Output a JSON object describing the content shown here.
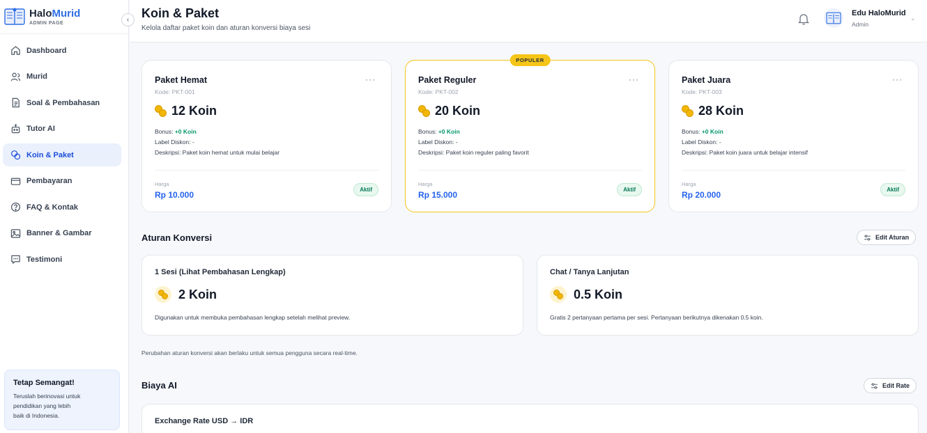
{
  "brand": {
    "name_main": "Halo",
    "name_accent": "Murid",
    "subtitle": "ADMIN PAGE"
  },
  "sidebar": {
    "items": [
      {
        "label": "Dashboard",
        "icon": "home-icon"
      },
      {
        "label": "Murid",
        "icon": "users-icon"
      },
      {
        "label": "Soal & Pembahasan",
        "icon": "document-icon"
      },
      {
        "label": "Tutor AI",
        "icon": "robot-icon"
      },
      {
        "label": "Koin & Paket",
        "icon": "coins-icon",
        "active": true
      },
      {
        "label": "Pembayaran",
        "icon": "card-icon"
      },
      {
        "label": "FAQ & Kontak",
        "icon": "help-icon"
      },
      {
        "label": "Banner & Gambar",
        "icon": "image-icon"
      },
      {
        "label": "Testimoni",
        "icon": "chat-icon"
      }
    ],
    "promo": {
      "title": "Tetap Semangat!",
      "text": "Teruslah berinovasi untuk pendidikan yang lebih baik di Indonesia."
    }
  },
  "header": {
    "title": "Koin & Paket",
    "subtitle": "Kelola daftar paket koin dan aturan konversi biaya sesi",
    "user": {
      "name": "Edu HaloMurid",
      "role": "Admin"
    }
  },
  "packages": [
    {
      "name": "Paket Hemat",
      "code": "Kode: PKT-001",
      "koin": "12 Koin",
      "bonus_label": "Bonus:",
      "bonus": "+0 Koin",
      "diskon": "Label Diskon: -",
      "deskripsi": "Deskripsi: Paket koin hemat untuk mulai belajar",
      "price_label": "Harga",
      "price": "Rp 10.000",
      "status": "Aktif",
      "menu": "···"
    },
    {
      "name": "Paket Reguler",
      "code": "Kode: PKT-002",
      "koin": "20 Koin",
      "bonus_label": "Bonus:",
      "bonus": "+0 Koin",
      "diskon": "Label Diskon: -",
      "deskripsi": "Deskripsi: Paket koin reguler paling favorit",
      "price_label": "Harga",
      "price": "Rp 15.000",
      "status": "Aktif",
      "badge": "POPULER",
      "menu": "···"
    },
    {
      "name": "Paket Juara",
      "code": "Kode: PKT-003",
      "koin": "28 Koin",
      "bonus_label": "Bonus:",
      "bonus": "+0 Koin",
      "diskon": "Label Diskon: -",
      "deskripsi": "Deskripsi: Paket koin juara untuk belajar intensif",
      "price_label": "Harga",
      "price": "Rp 20.000",
      "status": "Aktif",
      "menu": "···"
    }
  ],
  "conversion": {
    "title": "Aturan Konversi",
    "edit_label": "Edit Aturan",
    "rules": [
      {
        "title": "1 Sesi (Lihat Pembahasan Lengkap)",
        "koin": "2 Koin",
        "desc": "Digunakan untuk membuka pembahasan lengkap setelah melihat preview."
      },
      {
        "title": "Chat / Tanya Lanjutan",
        "koin": "0.5 Koin",
        "desc": "Gratis 2 pertanyaan pertama per sesi. Pertanyaan berikutnya dikenakan 0.5 koin."
      }
    ],
    "note": "Perubahan aturan konversi akan berlaku untuk semua pengguna secara real-time."
  },
  "ai_cost": {
    "title": "Biaya AI",
    "edit_label": "Edit Rate",
    "card_title": "Exchange Rate USD → IDR"
  },
  "colors": {
    "accent": "#2f6fe4",
    "coin": "#f2b705",
    "popular_border": "#f5c518",
    "status_green": "#047857"
  }
}
